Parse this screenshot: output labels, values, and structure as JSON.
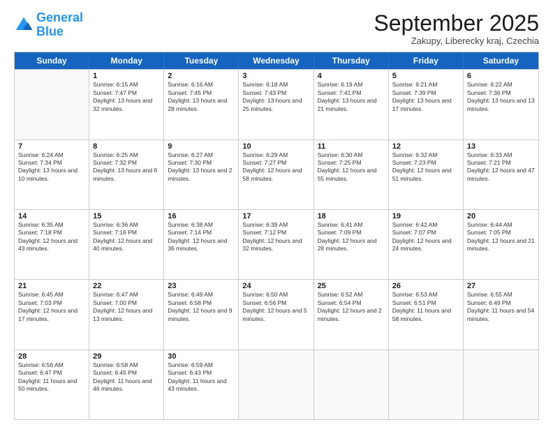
{
  "logo": {
    "line1": "General",
    "line2": "Blue"
  },
  "title": "September 2025",
  "location": "Zakupy, Liberecky kraj, Czechia",
  "days_header": [
    "Sunday",
    "Monday",
    "Tuesday",
    "Wednesday",
    "Thursday",
    "Friday",
    "Saturday"
  ],
  "weeks": [
    [
      {
        "day": "",
        "sunrise": "",
        "sunset": "",
        "daylight": ""
      },
      {
        "day": "1",
        "sunrise": "Sunrise: 6:15 AM",
        "sunset": "Sunset: 7:47 PM",
        "daylight": "Daylight: 13 hours and 32 minutes."
      },
      {
        "day": "2",
        "sunrise": "Sunrise: 6:16 AM",
        "sunset": "Sunset: 7:45 PM",
        "daylight": "Daylight: 13 hours and 28 minutes."
      },
      {
        "day": "3",
        "sunrise": "Sunrise: 6:18 AM",
        "sunset": "Sunset: 7:43 PM",
        "daylight": "Daylight: 13 hours and 25 minutes."
      },
      {
        "day": "4",
        "sunrise": "Sunrise: 6:19 AM",
        "sunset": "Sunset: 7:41 PM",
        "daylight": "Daylight: 13 hours and 21 minutes."
      },
      {
        "day": "5",
        "sunrise": "Sunrise: 6:21 AM",
        "sunset": "Sunset: 7:39 PM",
        "daylight": "Daylight: 13 hours and 17 minutes."
      },
      {
        "day": "6",
        "sunrise": "Sunrise: 6:22 AM",
        "sunset": "Sunset: 7:36 PM",
        "daylight": "Daylight: 13 hours and 13 minutes."
      }
    ],
    [
      {
        "day": "7",
        "sunrise": "Sunrise: 6:24 AM",
        "sunset": "Sunset: 7:34 PM",
        "daylight": "Daylight: 13 hours and 10 minutes."
      },
      {
        "day": "8",
        "sunrise": "Sunrise: 6:25 AM",
        "sunset": "Sunset: 7:32 PM",
        "daylight": "Daylight: 13 hours and 6 minutes."
      },
      {
        "day": "9",
        "sunrise": "Sunrise: 6:27 AM",
        "sunset": "Sunset: 7:30 PM",
        "daylight": "Daylight: 13 hours and 2 minutes."
      },
      {
        "day": "10",
        "sunrise": "Sunrise: 6:29 AM",
        "sunset": "Sunset: 7:27 PM",
        "daylight": "Daylight: 12 hours and 58 minutes."
      },
      {
        "day": "11",
        "sunrise": "Sunrise: 6:30 AM",
        "sunset": "Sunset: 7:25 PM",
        "daylight": "Daylight: 12 hours and 55 minutes."
      },
      {
        "day": "12",
        "sunrise": "Sunrise: 6:32 AM",
        "sunset": "Sunset: 7:23 PM",
        "daylight": "Daylight: 12 hours and 51 minutes."
      },
      {
        "day": "13",
        "sunrise": "Sunrise: 6:33 AM",
        "sunset": "Sunset: 7:21 PM",
        "daylight": "Daylight: 12 hours and 47 minutes."
      }
    ],
    [
      {
        "day": "14",
        "sunrise": "Sunrise: 6:35 AM",
        "sunset": "Sunset: 7:18 PM",
        "daylight": "Daylight: 12 hours and 43 minutes."
      },
      {
        "day": "15",
        "sunrise": "Sunrise: 6:36 AM",
        "sunset": "Sunset: 7:16 PM",
        "daylight": "Daylight: 12 hours and 40 minutes."
      },
      {
        "day": "16",
        "sunrise": "Sunrise: 6:38 AM",
        "sunset": "Sunset: 7:14 PM",
        "daylight": "Daylight: 12 hours and 36 minutes."
      },
      {
        "day": "17",
        "sunrise": "Sunrise: 6:39 AM",
        "sunset": "Sunset: 7:12 PM",
        "daylight": "Daylight: 12 hours and 32 minutes."
      },
      {
        "day": "18",
        "sunrise": "Sunrise: 6:41 AM",
        "sunset": "Sunset: 7:09 PM",
        "daylight": "Daylight: 12 hours and 28 minutes."
      },
      {
        "day": "19",
        "sunrise": "Sunrise: 6:42 AM",
        "sunset": "Sunset: 7:07 PM",
        "daylight": "Daylight: 12 hours and 24 minutes."
      },
      {
        "day": "20",
        "sunrise": "Sunrise: 6:44 AM",
        "sunset": "Sunset: 7:05 PM",
        "daylight": "Daylight: 12 hours and 21 minutes."
      }
    ],
    [
      {
        "day": "21",
        "sunrise": "Sunrise: 6:45 AM",
        "sunset": "Sunset: 7:03 PM",
        "daylight": "Daylight: 12 hours and 17 minutes."
      },
      {
        "day": "22",
        "sunrise": "Sunrise: 6:47 AM",
        "sunset": "Sunset: 7:00 PM",
        "daylight": "Daylight: 12 hours and 13 minutes."
      },
      {
        "day": "23",
        "sunrise": "Sunrise: 6:49 AM",
        "sunset": "Sunset: 6:58 PM",
        "daylight": "Daylight: 12 hours and 9 minutes."
      },
      {
        "day": "24",
        "sunrise": "Sunrise: 6:50 AM",
        "sunset": "Sunset: 6:56 PM",
        "daylight": "Daylight: 12 hours and 5 minutes."
      },
      {
        "day": "25",
        "sunrise": "Sunrise: 6:52 AM",
        "sunset": "Sunset: 6:54 PM",
        "daylight": "Daylight: 12 hours and 2 minutes."
      },
      {
        "day": "26",
        "sunrise": "Sunrise: 6:53 AM",
        "sunset": "Sunset: 6:51 PM",
        "daylight": "Daylight: 11 hours and 58 minutes."
      },
      {
        "day": "27",
        "sunrise": "Sunrise: 6:55 AM",
        "sunset": "Sunset: 6:49 PM",
        "daylight": "Daylight: 11 hours and 54 minutes."
      }
    ],
    [
      {
        "day": "28",
        "sunrise": "Sunrise: 6:56 AM",
        "sunset": "Sunset: 6:47 PM",
        "daylight": "Daylight: 11 hours and 50 minutes."
      },
      {
        "day": "29",
        "sunrise": "Sunrise: 6:58 AM",
        "sunset": "Sunset: 6:45 PM",
        "daylight": "Daylight: 11 hours and 46 minutes."
      },
      {
        "day": "30",
        "sunrise": "Sunrise: 6:59 AM",
        "sunset": "Sunset: 6:43 PM",
        "daylight": "Daylight: 11 hours and 43 minutes."
      },
      {
        "day": "",
        "sunrise": "",
        "sunset": "",
        "daylight": ""
      },
      {
        "day": "",
        "sunrise": "",
        "sunset": "",
        "daylight": ""
      },
      {
        "day": "",
        "sunrise": "",
        "sunset": "",
        "daylight": ""
      },
      {
        "day": "",
        "sunrise": "",
        "sunset": "",
        "daylight": ""
      }
    ]
  ]
}
